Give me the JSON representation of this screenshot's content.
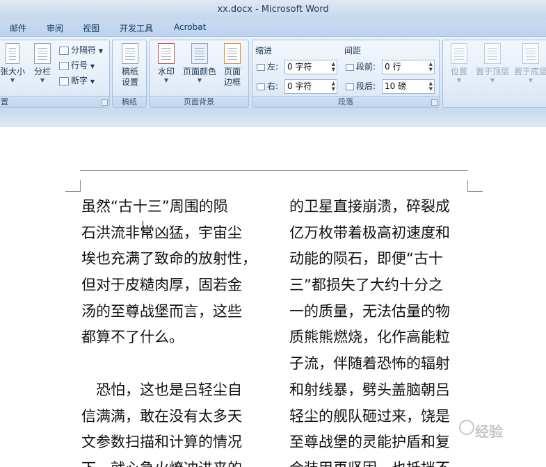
{
  "window": {
    "title": "xx.docx - Microsoft Word"
  },
  "ribbon_tabs": [
    "邮件",
    "审阅",
    "视图",
    "开发工具",
    "Acrobat"
  ],
  "page_setup_group": {
    "label": "置",
    "paper_size": "张大小",
    "columns": "分栏",
    "breaks": "分隔符",
    "line_numbers": "行号",
    "hyphenation": "断字"
  },
  "manuscript_group": {
    "label": "稿纸",
    "button": [
      "稿纸",
      "设置"
    ]
  },
  "page_background_group": {
    "label": "页面背景",
    "watermark": "水印",
    "page_color": "页面颜色",
    "page_borders": [
      "页面",
      "边框"
    ]
  },
  "paragraph_group": {
    "label": "段落",
    "indent_header": "缩进",
    "spacing_header": "间距",
    "left_label": "左:",
    "left_value": "0 字符",
    "right_label": "右:",
    "right_value": "0 字符",
    "before_label": "段前:",
    "before_value": "0 行",
    "after_label": "段后:",
    "after_value": "10 磅"
  },
  "arrange_group": {
    "position": "位置",
    "bring_to_front": "置于顶层",
    "send_to_back": "置于底层"
  },
  "document": {
    "column1": [
      "虽然“古十三”周围的陨",
      "石洪流非常凶猛，宇宙尘",
      "埃也充满了致命的放射性，",
      "但对于皮糙肉厚，固若金",
      "汤的至尊战堡而言，这些",
      "都算不了什么。",
      "",
      "　恐怕，这也是吕轻尘自",
      "信满满，敢在没有太多天",
      "文参数扫描和计算的情况",
      "下，就心急火燎冲进来的"
    ],
    "column2": [
      "的卫星直接崩溃，碎裂成",
      "亿万枚带着极高初速度和",
      "动能的陨石，即便“古十",
      "三”都损失了大约十分之",
      "一的质量，无法估量的物",
      "质熊熊燃烧，化作高能粒",
      "子流，伴随着恐怖的辐射",
      "和射线暴，劈头盖脑朝吕",
      "轻尘的舰队砸过来，饶是",
      "至尊战堡的灵能护盾和复",
      "合装甲再坚固，也抵挡不"
    ]
  },
  "watermark_text": "经验"
}
